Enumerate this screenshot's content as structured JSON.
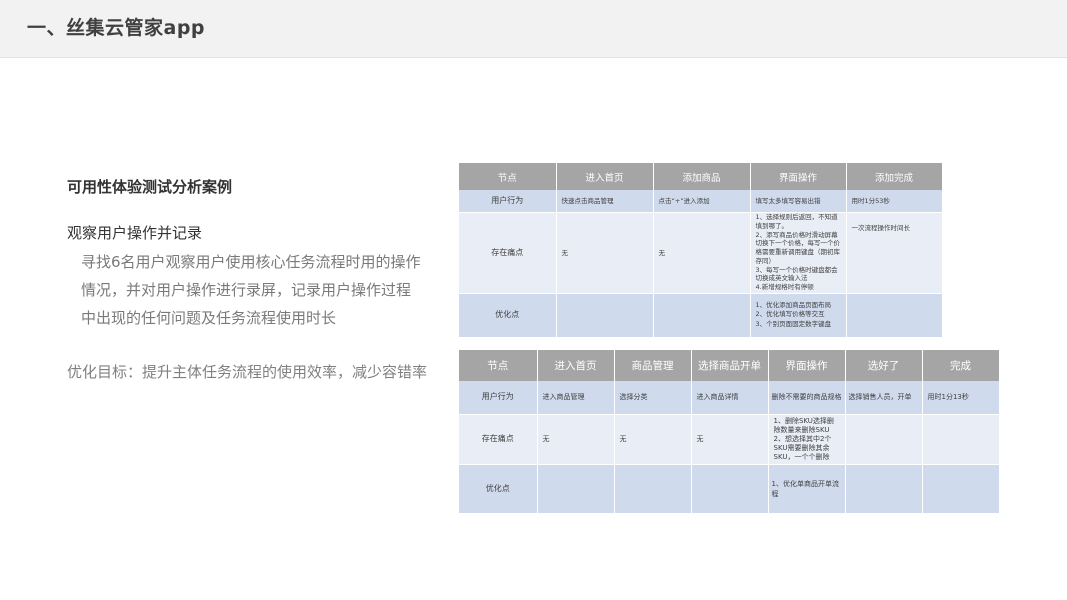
{
  "header": {
    "title": "一、丝集云管家app"
  },
  "left": {
    "case_title": "可用性体验测试分析案例",
    "observe_title": "观察用户操作并记录",
    "observe_desc": "寻找6名用户观察用户使用核心任务流程时用的操作情况，并对用户操作进行录屏，记录用户操作过程中出现的任何问题及任务流程使用时长",
    "goal": "优化目标：提升主体任务流程的使用效率，减少容错率"
  },
  "table1": {
    "headers": [
      "节点",
      "进入首页",
      "添加商品",
      "界面操作",
      "添加完成"
    ],
    "rows": [
      [
        "用户行为",
        "快速点击商品管理",
        "点击“+”进入添加",
        "填写太多填写容易出错",
        "用时1分53秒"
      ],
      [
        "存在痛点",
        "无",
        "无",
        "1、选择规则后返回，不知道填到哪了。\n2、添写商品价格时滑动屏幕切换下一个价格，每写一个价格需要重新调用键盘（期初库存同）\n3、每写一个价格时键盘都会切换成英文输入法\n4.新增规格时有停顿",
        "一次流程操作时间长"
      ],
      [
        "优化点",
        "",
        "",
        "1、优化添加商品页面布局\n2、优化填写价格等交互\n3、个别页面固定数字键盘",
        ""
      ]
    ]
  },
  "table2": {
    "headers": [
      "节点",
      "进入首页",
      "商品管理",
      "选择商品开单",
      "界面操作",
      "选好了",
      "完成"
    ],
    "rows": [
      [
        "用户行为",
        "进入商品管理",
        "选择分类",
        "进入商品详情",
        "删除不需要的商品规格",
        "选择销售人员，开单",
        "用时1分13秒"
      ],
      [
        "存在痛点",
        "无",
        "无",
        "无",
        "1、删除SKU选择删除数量来删除SKU\n2、想选择其中2个SKU需要删除其余SKU，一个个删除",
        "",
        ""
      ],
      [
        "优化点",
        "",
        "",
        "",
        "1、优化单商品开单流程",
        "",
        ""
      ]
    ]
  }
}
